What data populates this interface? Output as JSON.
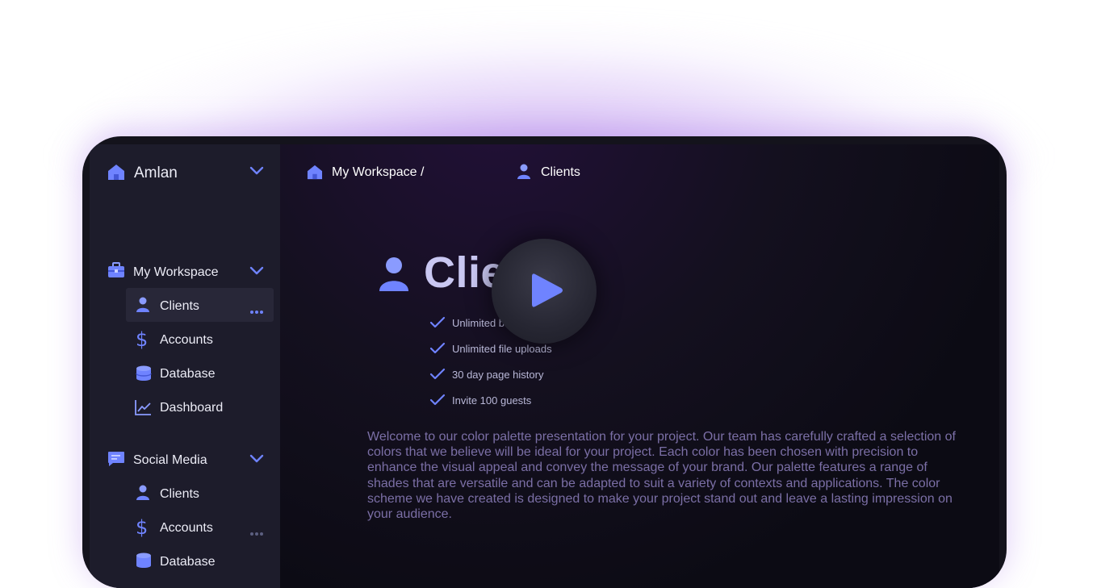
{
  "workspace_switcher": {
    "name": "Amlan",
    "icon": "house-icon"
  },
  "sidebar": {
    "groups": [
      {
        "label": "My Workspace",
        "icon": "briefcase-icon",
        "items": [
          {
            "label": "Clients",
            "icon": "user-icon",
            "active": true
          },
          {
            "label": "Accounts",
            "icon": "dollar-icon"
          },
          {
            "label": "Database",
            "icon": "database-icon"
          },
          {
            "label": "Dashboard",
            "icon": "chart-icon"
          }
        ]
      },
      {
        "label": "Social Media",
        "icon": "chat-icon",
        "items": [
          {
            "label": "Clients",
            "icon": "user-icon"
          },
          {
            "label": "Accounts",
            "icon": "dollar-icon"
          },
          {
            "label": "Database",
            "icon": "database-icon"
          }
        ]
      }
    ]
  },
  "breadcrumb": {
    "workspace": "My Workspace /",
    "page": "Clients"
  },
  "main": {
    "title": "Clients",
    "features": [
      "Unlimited b",
      "Unlimited file uploads",
      "30 day page history",
      "Invite 100 guests"
    ],
    "description": "Welcome to our color palette presentation for your project. Our team has carefully crafted a selection of colors that we believe will be ideal for your project. Each color has been chosen with precision to enhance the visual appeal and convey the message of your brand. Our palette features a range of shades that are versatile and can be adapted to suit a variety of contexts and applications. The color scheme we have created is designed to make your project stand out and leave a lasting impression on your audience."
  },
  "colors": {
    "accent": "#6f83ff",
    "sidebar_bg": "#1d1c2b",
    "main_bg": "#0c0b14",
    "glow": "#b37ee8"
  }
}
